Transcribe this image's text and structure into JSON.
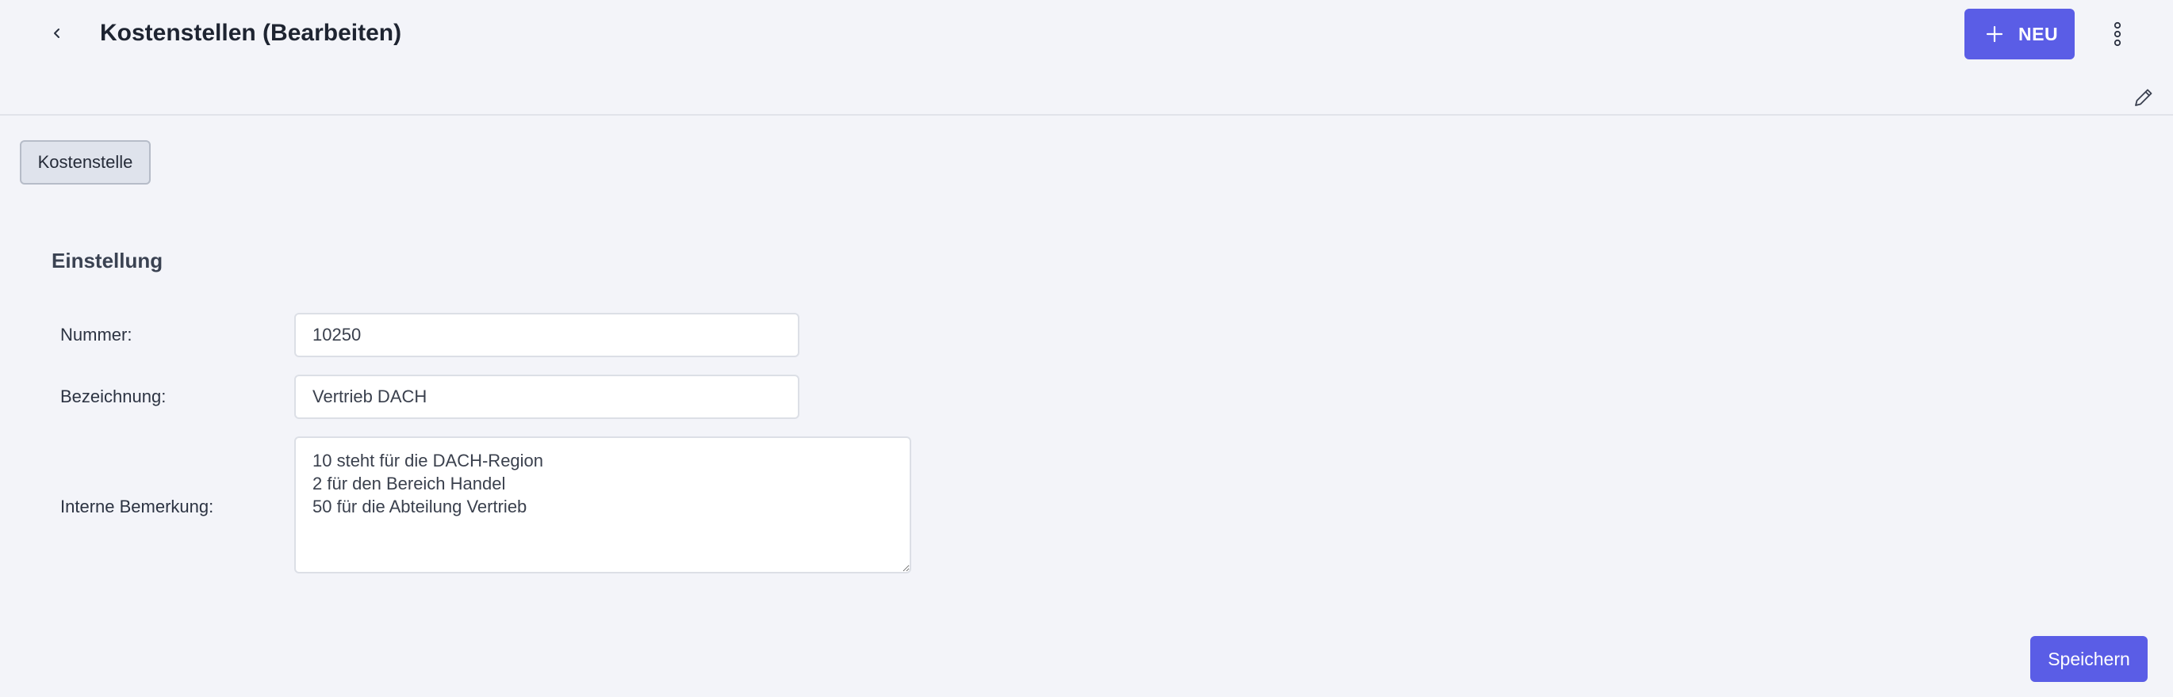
{
  "header": {
    "title": "Kostenstellen (Bearbeiten)",
    "new_button_label": "NEU",
    "icons": {
      "back": "chevron-left-icon",
      "new": "plus-icon",
      "more": "vertical-dots-icon",
      "edit": "pencil-icon"
    }
  },
  "tabs": [
    {
      "label": "Kostenstelle",
      "active": true
    }
  ],
  "section": {
    "heading": "Einstellung"
  },
  "form": {
    "nummer": {
      "label": "Nummer:",
      "value": "10250"
    },
    "bezeichnung": {
      "label": "Bezeichnung:",
      "value": "Vertrieb DACH"
    },
    "bemerkung": {
      "label": "Interne Bemerkung:",
      "value": "10 steht für die DACH-Region\n2 für den Bereich Handel\n50 für die Abteilung Vertrieb"
    }
  },
  "footer": {
    "save_label": "Speichern"
  },
  "colors": {
    "accent": "#5a5de6",
    "background": "#f3f4f9"
  }
}
